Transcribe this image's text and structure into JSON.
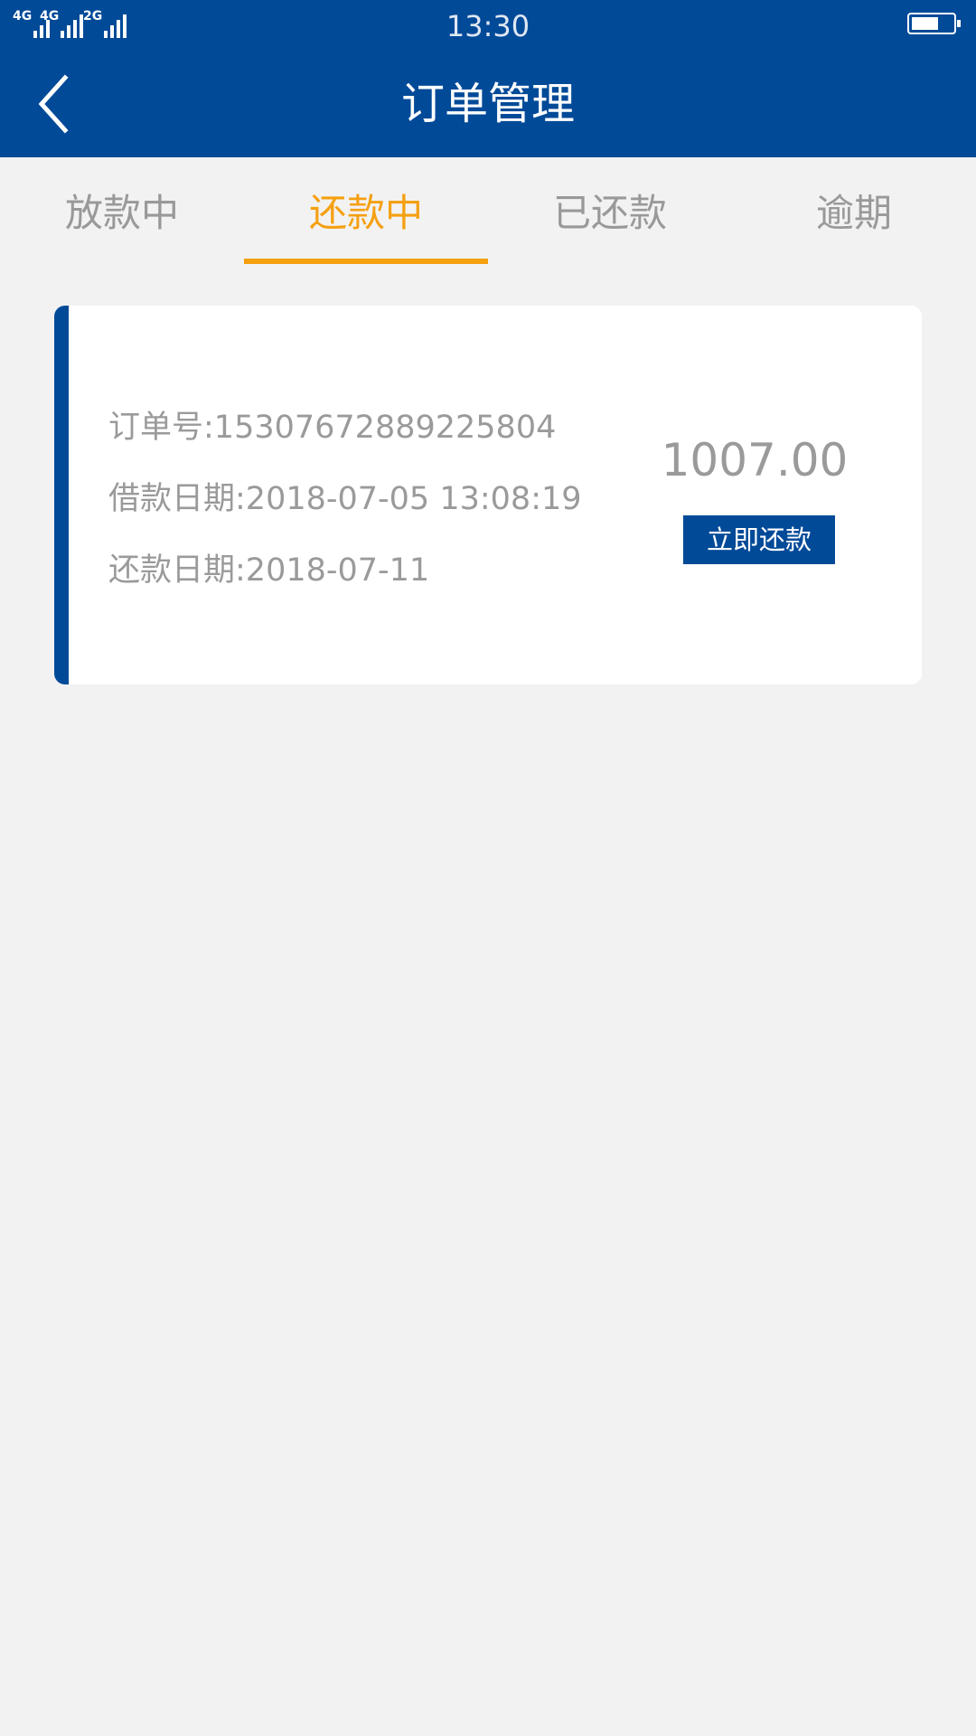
{
  "status_bar": {
    "time": "13:30",
    "network_1": "4G",
    "network_2": "4G",
    "network_3": "2G",
    "battery_level": 0.65
  },
  "header": {
    "title": "订单管理",
    "back_icon": "chevron-left-icon",
    "background": "#004a98"
  },
  "tabs": [
    {
      "label": "放款中",
      "active": false
    },
    {
      "label": "还款中",
      "active": true
    },
    {
      "label": "已还款",
      "active": false
    },
    {
      "label": "逾期",
      "active": false
    }
  ],
  "active_color": "#f5a011",
  "order": {
    "order_no_label": "订单号:",
    "order_no": "15307672889225804",
    "loan_date_label": "借款日期:",
    "loan_date": "2018-07-05 13:08:19",
    "repay_date_label": "还款日期:",
    "repay_date": "2018-07-11",
    "amount": "1007.00",
    "repay_button": "立即还款"
  }
}
